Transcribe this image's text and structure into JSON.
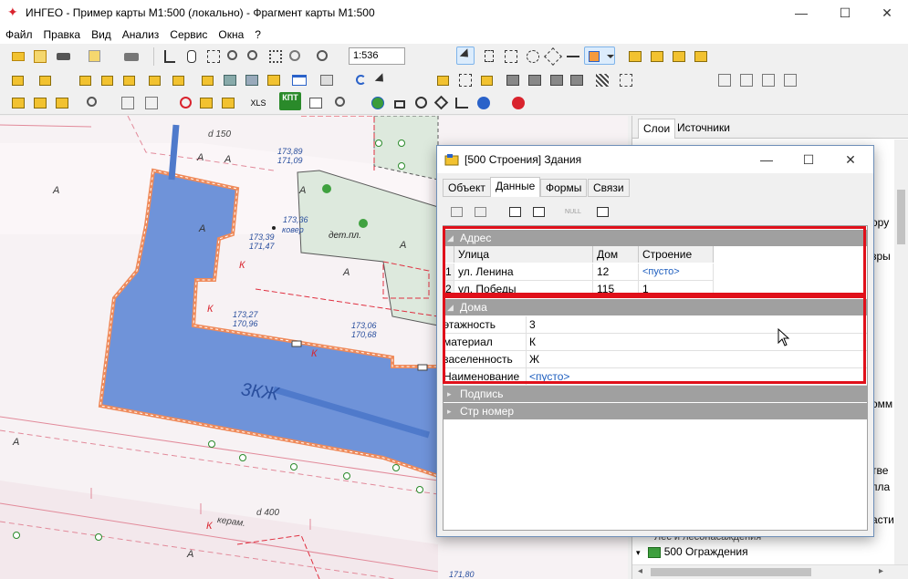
{
  "window": {
    "title": "ИНГЕО - Пример карты М1:500 (локально) - Фрагмент карты М1:500",
    "minimize": "—",
    "maximize": "☐",
    "close": "✕"
  },
  "menu": [
    "Файл",
    "Правка",
    "Вид",
    "Анализ",
    "Сервис",
    "Окна",
    "?"
  ],
  "toolbar": {
    "scale_value": "1:536",
    "xls_label": "XLS",
    "kpt_label": "КПТ"
  },
  "map": {
    "street_label_top": "d 150",
    "street_label_bottom": "d 400",
    "street_kerb": "керам.",
    "building_label": "3КЖ",
    "playground_label": "дет.пл.",
    "kover_label": "ковер",
    "heights": [
      {
        "a": "173,89",
        "b": "171,09"
      },
      {
        "a": "173,36",
        "b": ""
      },
      {
        "a": "173,39",
        "b": "171,47"
      },
      {
        "a": "173,27",
        "b": "170,96"
      },
      {
        "a": "173,06",
        "b": "170,68"
      }
    ],
    "height_bottom": "171,80",
    "letter_a": "А",
    "letter_k": "К"
  },
  "right_panel": {
    "tabs": [
      "Слои",
      "Источники"
    ],
    "active_tab": "Слои",
    "partial_texts": [
      "ору",
      "зры",
      "омм",
      "тве",
      "пла",
      "асти"
    ],
    "layer_items": [
      {
        "label": "Лес и лесонасаждения"
      },
      {
        "label": "500 Ограждения"
      }
    ]
  },
  "dialog": {
    "title": "[500 Строения] Здания",
    "tabs": [
      "Объект",
      "Данные",
      "Формы",
      "Связи"
    ],
    "active_tab": "Данные",
    "null_label": "NULL",
    "sections": {
      "address": {
        "header": "Адрес",
        "columns": [
          "Улица",
          "Дом",
          "Строение"
        ],
        "rows": [
          {
            "num": "1",
            "street": "ул. Ленина",
            "house": "12",
            "building": "<пусто>"
          },
          {
            "num": "2",
            "street": "ул. Победы",
            "house": "115",
            "building": "1"
          }
        ]
      },
      "houses": {
        "header": "Дома",
        "props": [
          {
            "label": "этажность",
            "value": "3"
          },
          {
            "label": "материал",
            "value": "К"
          },
          {
            "label": "заселенность",
            "value": "Ж"
          },
          {
            "label": "Наименование",
            "value": "<пусто>"
          }
        ]
      },
      "signature": {
        "header": "Подпись"
      },
      "house_number": {
        "header": "Стр номер"
      }
    }
  },
  "colors": {
    "building_fill": "#6f93d9",
    "building_outline": "#ef8a5a",
    "highlight": "#e0101a",
    "section_header": "#a0a0a0",
    "empty_value": "#1f5fbf"
  }
}
